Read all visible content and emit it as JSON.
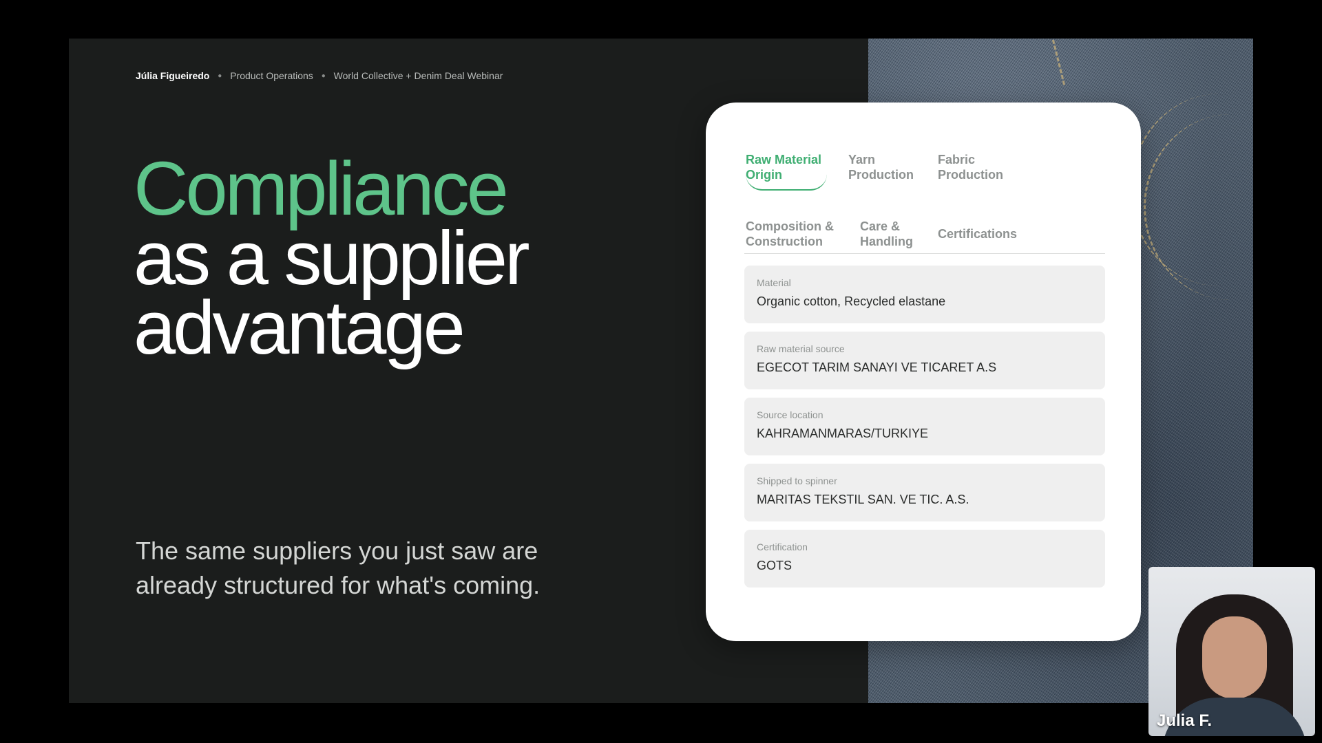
{
  "breadcrumb": {
    "presenter": "Júlia Figueiredo",
    "team": "Product Operations",
    "event": "World Collective + Denim Deal Webinar"
  },
  "headline": {
    "accent": "Compliance",
    "line2": "as a supplier",
    "line3": "advantage"
  },
  "subtext": "The same suppliers you just saw are already structured for what's coming.",
  "card": {
    "tabs": [
      {
        "line1": "Raw Material",
        "line2": "Origin",
        "active": true
      },
      {
        "line1": "Yarn",
        "line2": "Production",
        "active": false
      },
      {
        "line1": "Fabric",
        "line2": "Production",
        "active": false
      },
      {
        "line1": "Composition &",
        "line2": "Construction",
        "active": false
      },
      {
        "line1": "Care &",
        "line2": "Handling",
        "active": false
      },
      {
        "line1": "Certifications",
        "line2": "",
        "active": false
      }
    ],
    "fields": [
      {
        "label": "Material",
        "value": "Organic cotton, Recycled elastane"
      },
      {
        "label": "Raw material source",
        "value": "EGECOT TARIM SANAYI VE TICARET A.S"
      },
      {
        "label": "Source location",
        "value": "KAHRAMANMARAS/TURKIYE"
      },
      {
        "label": "Shipped to spinner",
        "value": "MARITAS TEKSTIL SAN. VE TIC. A.S."
      },
      {
        "label": "Certification",
        "value": "GOTS"
      }
    ]
  },
  "webcam": {
    "name": "Julia F."
  },
  "colors": {
    "accent_green": "#5ec48a",
    "tab_active": "#3fae72",
    "slide_bg": "#1b1d1c"
  }
}
